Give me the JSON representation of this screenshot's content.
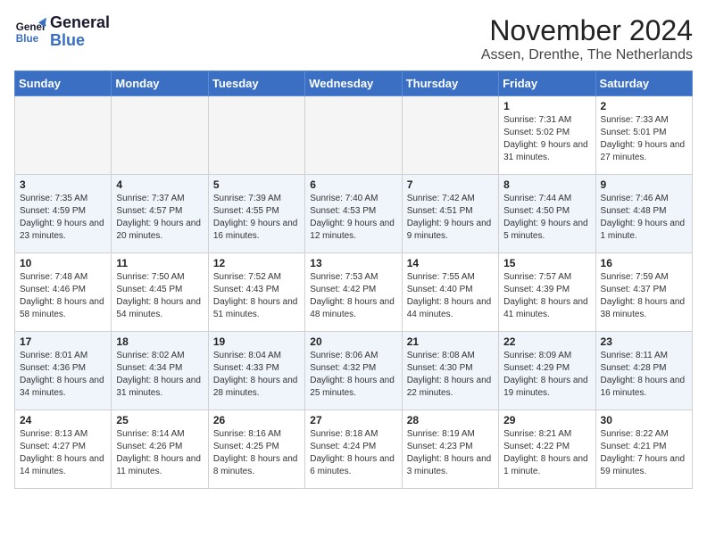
{
  "logo": {
    "line1": "General",
    "line2": "Blue"
  },
  "header": {
    "month": "November 2024",
    "location": "Assen, Drenthe, The Netherlands"
  },
  "weekdays": [
    "Sunday",
    "Monday",
    "Tuesday",
    "Wednesday",
    "Thursday",
    "Friday",
    "Saturday"
  ],
  "weeks": [
    [
      {
        "day": "",
        "info": ""
      },
      {
        "day": "",
        "info": ""
      },
      {
        "day": "",
        "info": ""
      },
      {
        "day": "",
        "info": ""
      },
      {
        "day": "",
        "info": ""
      },
      {
        "day": "1",
        "info": "Sunrise: 7:31 AM\nSunset: 5:02 PM\nDaylight: 9 hours and 31 minutes."
      },
      {
        "day": "2",
        "info": "Sunrise: 7:33 AM\nSunset: 5:01 PM\nDaylight: 9 hours and 27 minutes."
      }
    ],
    [
      {
        "day": "3",
        "info": "Sunrise: 7:35 AM\nSunset: 4:59 PM\nDaylight: 9 hours and 23 minutes."
      },
      {
        "day": "4",
        "info": "Sunrise: 7:37 AM\nSunset: 4:57 PM\nDaylight: 9 hours and 20 minutes."
      },
      {
        "day": "5",
        "info": "Sunrise: 7:39 AM\nSunset: 4:55 PM\nDaylight: 9 hours and 16 minutes."
      },
      {
        "day": "6",
        "info": "Sunrise: 7:40 AM\nSunset: 4:53 PM\nDaylight: 9 hours and 12 minutes."
      },
      {
        "day": "7",
        "info": "Sunrise: 7:42 AM\nSunset: 4:51 PM\nDaylight: 9 hours and 9 minutes."
      },
      {
        "day": "8",
        "info": "Sunrise: 7:44 AM\nSunset: 4:50 PM\nDaylight: 9 hours and 5 minutes."
      },
      {
        "day": "9",
        "info": "Sunrise: 7:46 AM\nSunset: 4:48 PM\nDaylight: 9 hours and 1 minute."
      }
    ],
    [
      {
        "day": "10",
        "info": "Sunrise: 7:48 AM\nSunset: 4:46 PM\nDaylight: 8 hours and 58 minutes."
      },
      {
        "day": "11",
        "info": "Sunrise: 7:50 AM\nSunset: 4:45 PM\nDaylight: 8 hours and 54 minutes."
      },
      {
        "day": "12",
        "info": "Sunrise: 7:52 AM\nSunset: 4:43 PM\nDaylight: 8 hours and 51 minutes."
      },
      {
        "day": "13",
        "info": "Sunrise: 7:53 AM\nSunset: 4:42 PM\nDaylight: 8 hours and 48 minutes."
      },
      {
        "day": "14",
        "info": "Sunrise: 7:55 AM\nSunset: 4:40 PM\nDaylight: 8 hours and 44 minutes."
      },
      {
        "day": "15",
        "info": "Sunrise: 7:57 AM\nSunset: 4:39 PM\nDaylight: 8 hours and 41 minutes."
      },
      {
        "day": "16",
        "info": "Sunrise: 7:59 AM\nSunset: 4:37 PM\nDaylight: 8 hours and 38 minutes."
      }
    ],
    [
      {
        "day": "17",
        "info": "Sunrise: 8:01 AM\nSunset: 4:36 PM\nDaylight: 8 hours and 34 minutes."
      },
      {
        "day": "18",
        "info": "Sunrise: 8:02 AM\nSunset: 4:34 PM\nDaylight: 8 hours and 31 minutes."
      },
      {
        "day": "19",
        "info": "Sunrise: 8:04 AM\nSunset: 4:33 PM\nDaylight: 8 hours and 28 minutes."
      },
      {
        "day": "20",
        "info": "Sunrise: 8:06 AM\nSunset: 4:32 PM\nDaylight: 8 hours and 25 minutes."
      },
      {
        "day": "21",
        "info": "Sunrise: 8:08 AM\nSunset: 4:30 PM\nDaylight: 8 hours and 22 minutes."
      },
      {
        "day": "22",
        "info": "Sunrise: 8:09 AM\nSunset: 4:29 PM\nDaylight: 8 hours and 19 minutes."
      },
      {
        "day": "23",
        "info": "Sunrise: 8:11 AM\nSunset: 4:28 PM\nDaylight: 8 hours and 16 minutes."
      }
    ],
    [
      {
        "day": "24",
        "info": "Sunrise: 8:13 AM\nSunset: 4:27 PM\nDaylight: 8 hours and 14 minutes."
      },
      {
        "day": "25",
        "info": "Sunrise: 8:14 AM\nSunset: 4:26 PM\nDaylight: 8 hours and 11 minutes."
      },
      {
        "day": "26",
        "info": "Sunrise: 8:16 AM\nSunset: 4:25 PM\nDaylight: 8 hours and 8 minutes."
      },
      {
        "day": "27",
        "info": "Sunrise: 8:18 AM\nSunset: 4:24 PM\nDaylight: 8 hours and 6 minutes."
      },
      {
        "day": "28",
        "info": "Sunrise: 8:19 AM\nSunset: 4:23 PM\nDaylight: 8 hours and 3 minutes."
      },
      {
        "day": "29",
        "info": "Sunrise: 8:21 AM\nSunset: 4:22 PM\nDaylight: 8 hours and 1 minute."
      },
      {
        "day": "30",
        "info": "Sunrise: 8:22 AM\nSunset: 4:21 PM\nDaylight: 7 hours and 59 minutes."
      }
    ]
  ]
}
